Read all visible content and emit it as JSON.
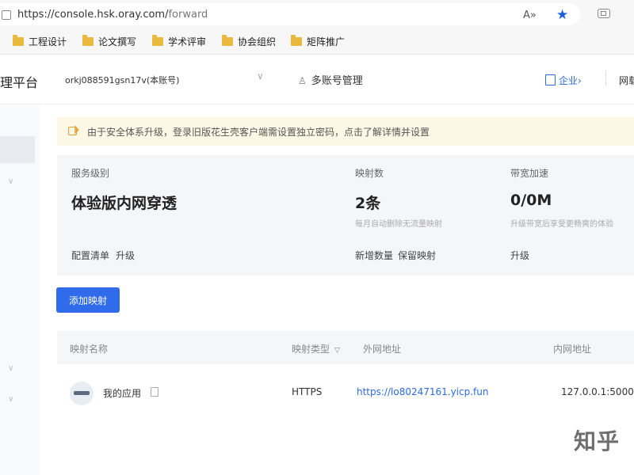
{
  "browser": {
    "url_prefix": "https://console.hsk.oray.com/",
    "url_path": "forward",
    "read_aloud_icon": "A»",
    "bookmarks": [
      {
        "label": "工程设计"
      },
      {
        "label": "论文撰写"
      },
      {
        "label": "学术评审"
      },
      {
        "label": "协会组织"
      },
      {
        "label": "矩阵推广"
      }
    ]
  },
  "header": {
    "brand": "理平台",
    "account": "orkj088591gsn17v(本账号)",
    "multi_account": "多账号管理",
    "enterprise": "企业",
    "help": "网载"
  },
  "notice": {
    "text": "由于安全体系升级，登录旧版花生壳客户端需设置独立密码，点击了解详情并设置"
  },
  "stats": {
    "service": {
      "label": "服务级别",
      "value": "体验版内网穿透",
      "links": [
        "配置清单",
        "升级"
      ]
    },
    "mappings": {
      "label": "映射数",
      "value": "2条",
      "sub": "每月自动删除无流量映射",
      "links": [
        "新增数量",
        "保留映射"
      ]
    },
    "bandwidth": {
      "label": "带宽加速",
      "value": "0/0M",
      "sub": "升级带宽后享受更畅爽的体验",
      "links": [
        "升级"
      ]
    }
  },
  "actions": {
    "add_mapping": "添加映射"
  },
  "table": {
    "headers": {
      "name": "映射名称",
      "type": "映射类型",
      "external": "外网地址",
      "internal": "内网地址"
    },
    "rows": [
      {
        "name": "我的应用",
        "type": "HTTPS",
        "external": "https://lo80247161.yicp.fun",
        "internal": "127.0.0.1:5000"
      }
    ]
  },
  "watermark": "知乎",
  "colors": {
    "accent": "#2f6bea",
    "link": "#2d6ae3",
    "notice_bg": "#fdf8e6",
    "panel_bg": "#f5f6f8"
  }
}
